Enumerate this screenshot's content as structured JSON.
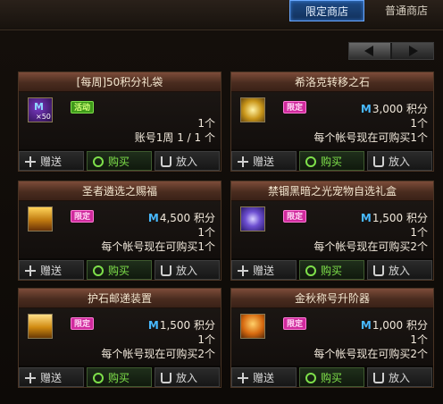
{
  "tabs": {
    "limited": "限定商店",
    "normal": "普通商店"
  },
  "pager": {
    "prev_icon": "left-arrow-icon",
    "next_icon": "right-arrow-icon"
  },
  "cards": [
    {
      "title": "[每周]50积分礼袋",
      "icon": "mileage-box-icon",
      "badge": "活动",
      "icon_label": "M",
      "icon_qty": "×50",
      "qty": "1个",
      "limit": "账号1周 1 / 1 个",
      "actions": {
        "gift": "赠送",
        "buy": "购买",
        "cart": "放入"
      }
    },
    {
      "title": "希洛克转移之石",
      "icon": "golden-stone-icon",
      "badge": "限定",
      "price_icon": "M",
      "price": "3,000 积分",
      "qty": "1个",
      "limit": "每个帐号现在可购买1个",
      "actions": {
        "gift": "赠送",
        "buy": "购买",
        "cart": "放入"
      }
    },
    {
      "title": "圣者遴选之赐福",
      "icon": "treasure-chest-icon",
      "badge": "限定",
      "price_icon": "M",
      "price": "4,500 积分",
      "qty": "1个",
      "limit": "每个帐号现在可购买1个",
      "actions": {
        "gift": "赠送",
        "buy": "购买",
        "cart": "放入"
      }
    },
    {
      "title": "禁锢黑暗之光宠物自选礼盒",
      "icon": "pet-box-icon",
      "badge": "限定",
      "price_icon": "M",
      "price": "1,500 积分",
      "qty": "1个",
      "limit": "每个帐号现在可购买2个",
      "actions": {
        "gift": "赠送",
        "buy": "购买",
        "cart": "放入"
      }
    },
    {
      "title": "护石邮递装置",
      "icon": "gold-box-icon",
      "badge": "限定",
      "price_icon": "M",
      "price": "1,500 积分",
      "qty": "1个",
      "limit": "每个帐号现在可购买2个",
      "actions": {
        "gift": "赠送",
        "buy": "购买",
        "cart": "放入"
      }
    },
    {
      "title": "金秋称号升阶器",
      "icon": "title-upgrade-icon",
      "badge": "限定",
      "price_icon": "M",
      "price": "1,000 积分",
      "qty": "1个",
      "limit": "每个帐号现在可购买2个",
      "actions": {
        "gift": "赠送",
        "buy": "购买",
        "cart": "放入"
      }
    }
  ]
}
